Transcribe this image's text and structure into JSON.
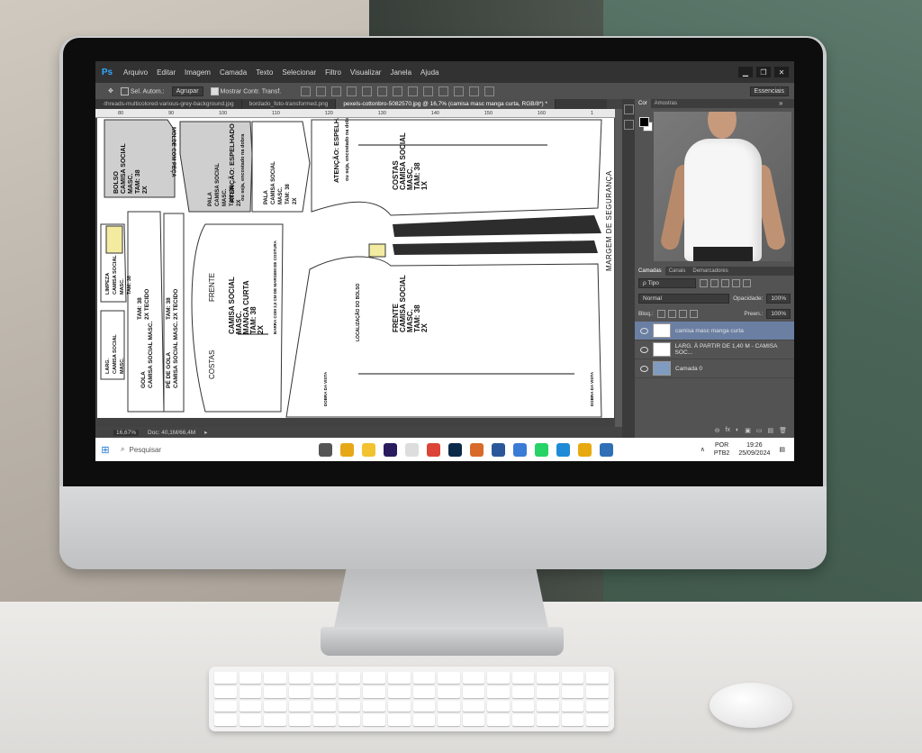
{
  "menubar": {
    "logo": "Ps",
    "items": [
      "Arquivo",
      "Editar",
      "Imagem",
      "Camada",
      "Texto",
      "Selecionar",
      "Filtro",
      "Visualizar",
      "Janela",
      "Ajuda"
    ],
    "window_controls": [
      "▁",
      "❐",
      "✕"
    ]
  },
  "options_bar": {
    "tool_icon": "move-tool-icon",
    "auto_select_label": "Sel. Autom.:",
    "auto_select_value": "Agrupar",
    "show_transform_label": "Mostrar Contr. Transf.",
    "workspace": "Essenciais"
  },
  "tabs": [
    {
      "label": "-threads-multicolored-various-grey-background.jpg"
    },
    {
      "label": "bordado_foto-transformed.png"
    },
    {
      "label": "pexels-cottonbro-5082570.jpg @ 16,7% (camisa masc manga curta, RGB/8*) *"
    }
  ],
  "ruler_ticks": [
    "80",
    "90",
    "100",
    "110",
    "120",
    "130",
    "140",
    "150",
    "160",
    "1"
  ],
  "pattern": {
    "bolso": "BOLSO\nCAMISA SOCIAL\nMASC.\nTAM: 38\n2X",
    "molde": "MOLDE COM PEÇA",
    "atencao": "ATENÇÃO: ESPELHADO",
    "atencao_sub": "ou seja, encostado na dobra",
    "pala": "PALA\nCAMISA SOCIAL\nMASC.\nTAM: 38\n2X",
    "costas_back": "COSTAS\nCAMISA SOCIAL\nMASC.\nTAM: 38\n1X",
    "limpeza": "LIMPEZA\nCAMISA SOCIAL\nMASC.\nTAM: 38",
    "largura": "LARG.\nCAMISA SOCIAL\nMASC.",
    "gola": "GOLA\nCAMISA SOCIAL MASC.",
    "pe_de_gola": "PÉ DE GOLA\nCAMISA SOCIAL MASC.",
    "tam_tecido": "TAM: 38\n2X TECIDO",
    "frente_label": "FRENTE",
    "costas_label": "COSTAS",
    "manga": "CAMISA SOCIAL\nMASC.\nMANGA CURTA\nTAM: 38\n2X",
    "barra": "BARRA COM 3,5 CM DE MARGEM DE COSTURA",
    "frente_front": "FRENTE\nCAMISA SOCIAL\nMASC.\nTAM: 38\n2X",
    "localizacao": "LOCALIZAÇÃO DO BOLSO",
    "dobra_vista_1": "DOBRA DA VISTA",
    "dobra_vista_2": "DOBRA DA VISTA",
    "margem": "MARGEM DE SEGURANÇA"
  },
  "status_bar": {
    "zoom": "16,67%",
    "doc": "Doc: 40,1M/66,4M"
  },
  "panels": {
    "color_tabs": [
      "Cor",
      "Amostras"
    ],
    "layers_tabs": [
      "Camadas",
      "Canais",
      "Demarcadores"
    ],
    "filter_label": "ρ Tipo",
    "blend_mode": "Normal",
    "opacity_label": "Opacidade:",
    "opacity_value": "100%",
    "lock_label": "Bloq.:",
    "fill_label": "Preen.:",
    "fill_value": "100%",
    "layers": [
      {
        "name": "camisa masc manga curta",
        "active": true
      },
      {
        "name": "LARG. À PARTIR DE 1,40 M - CAMISA SOC...",
        "active": false
      },
      {
        "name": "Camada 0",
        "active": false
      }
    ],
    "bottom_icons": [
      "⊖",
      "fx",
      "◐",
      "▣",
      "▭",
      "▤",
      "🗑"
    ]
  },
  "taskbar": {
    "start_icon": "windows-icon",
    "search_placeholder": "Pesquisar",
    "apps": [
      {
        "name": "task-view-icon",
        "color": "#555555"
      },
      {
        "name": "app-yellow-icon",
        "color": "#e6a817"
      },
      {
        "name": "file-explorer-icon",
        "color": "#f2c230"
      },
      {
        "name": "premiere-icon",
        "color": "#2a1a5e"
      },
      {
        "name": "document-icon",
        "color": "#dddddd"
      },
      {
        "name": "chrome-icon",
        "color": "#db4437"
      },
      {
        "name": "photoshop-icon",
        "color": "#0b2a4a"
      },
      {
        "name": "media-icon",
        "color": "#d86a2b"
      },
      {
        "name": "word-icon",
        "color": "#2b579a"
      },
      {
        "name": "app-blue-icon",
        "color": "#3a7bd5"
      },
      {
        "name": "whatsapp-icon",
        "color": "#25d366"
      },
      {
        "name": "edge-icon",
        "color": "#1f8ad6"
      },
      {
        "name": "chrome-icon-2",
        "color": "#e8a90e"
      },
      {
        "name": "photos-icon",
        "color": "#2f6fb5"
      }
    ],
    "lang_line1": "POR",
    "lang_line2": "PTB2",
    "time": "19:26",
    "date": "25/09/2024"
  }
}
